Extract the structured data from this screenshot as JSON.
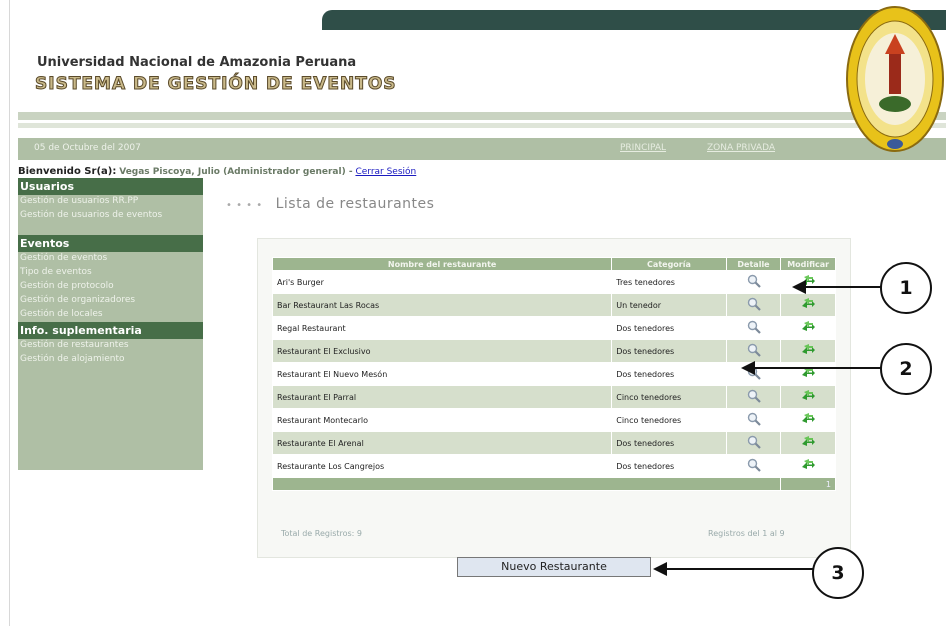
{
  "header": {
    "university": "Universidad Nacional de Amazonia Peruana",
    "system": "SISTEMA DE GESTIÓN DE EVENTOS",
    "date": "05 de Octubre del 2007",
    "nav": [
      "PRINCIPAL",
      "ZONA PRIVADA"
    ]
  },
  "welcome": {
    "label": "Bienvenido Sr(a):",
    "user": "Vegas Piscoya, Julio (Administrador general) -",
    "logout": "Cerrar Sesión"
  },
  "sidebar": {
    "usuarios_header": "Usuarios",
    "usuarios_items": [
      "Gestión de usuarios RR.PP",
      "Gestión de usuarios de eventos"
    ],
    "eventos_header": "Eventos",
    "eventos_items": [
      "Gestión de eventos",
      "Tipo de eventos",
      "Gestión de protocolo",
      "Gestión de organizadores",
      "Gestión de locales"
    ],
    "info_header": "Info. suplementaria",
    "info_items": [
      "Gestión de restaurantes",
      "Gestión de alojamiento"
    ]
  },
  "page": {
    "title": "Lista de restaurantes",
    "dots": "• • • •"
  },
  "table": {
    "headers": [
      "Nombre del restaurante",
      "Categoría",
      "Detalle",
      "Modificar"
    ],
    "rows": [
      {
        "name": "Ari's Burger",
        "category": "Tres tenedores"
      },
      {
        "name": "Bar Restaurant Las Rocas",
        "category": "Un tenedor"
      },
      {
        "name": "Regal Restaurant",
        "category": "Dos tenedores"
      },
      {
        "name": "Restaurant El Exclusivo",
        "category": "Dos tenedores"
      },
      {
        "name": "Restaurant El Nuevo Mesón",
        "category": "Dos tenedores"
      },
      {
        "name": "Restaurant El Parral",
        "category": "Cinco tenedores"
      },
      {
        "name": "Restaurant Montecarlo",
        "category": "Cinco tenedores"
      },
      {
        "name": "Restaurante El Arenal",
        "category": "Dos tenedores"
      },
      {
        "name": "Restaurante Los Cangrejos",
        "category": "Dos tenedores"
      }
    ],
    "footer_page": "1",
    "total": "Total de Registros: 9",
    "records": "Registros del 1 al 9"
  },
  "button": {
    "new": "Nuevo Restaurante"
  },
  "callouts": [
    "1",
    "2",
    "3"
  ],
  "icons": {
    "detail": "magnifier-icon",
    "modify": "green-arrows-icon"
  },
  "colors": {
    "dark_bar": "#2f4e48",
    "menu_bg": "#afbfa5",
    "menu_header": "#476e48",
    "row_alt": "#d6dfcc"
  }
}
